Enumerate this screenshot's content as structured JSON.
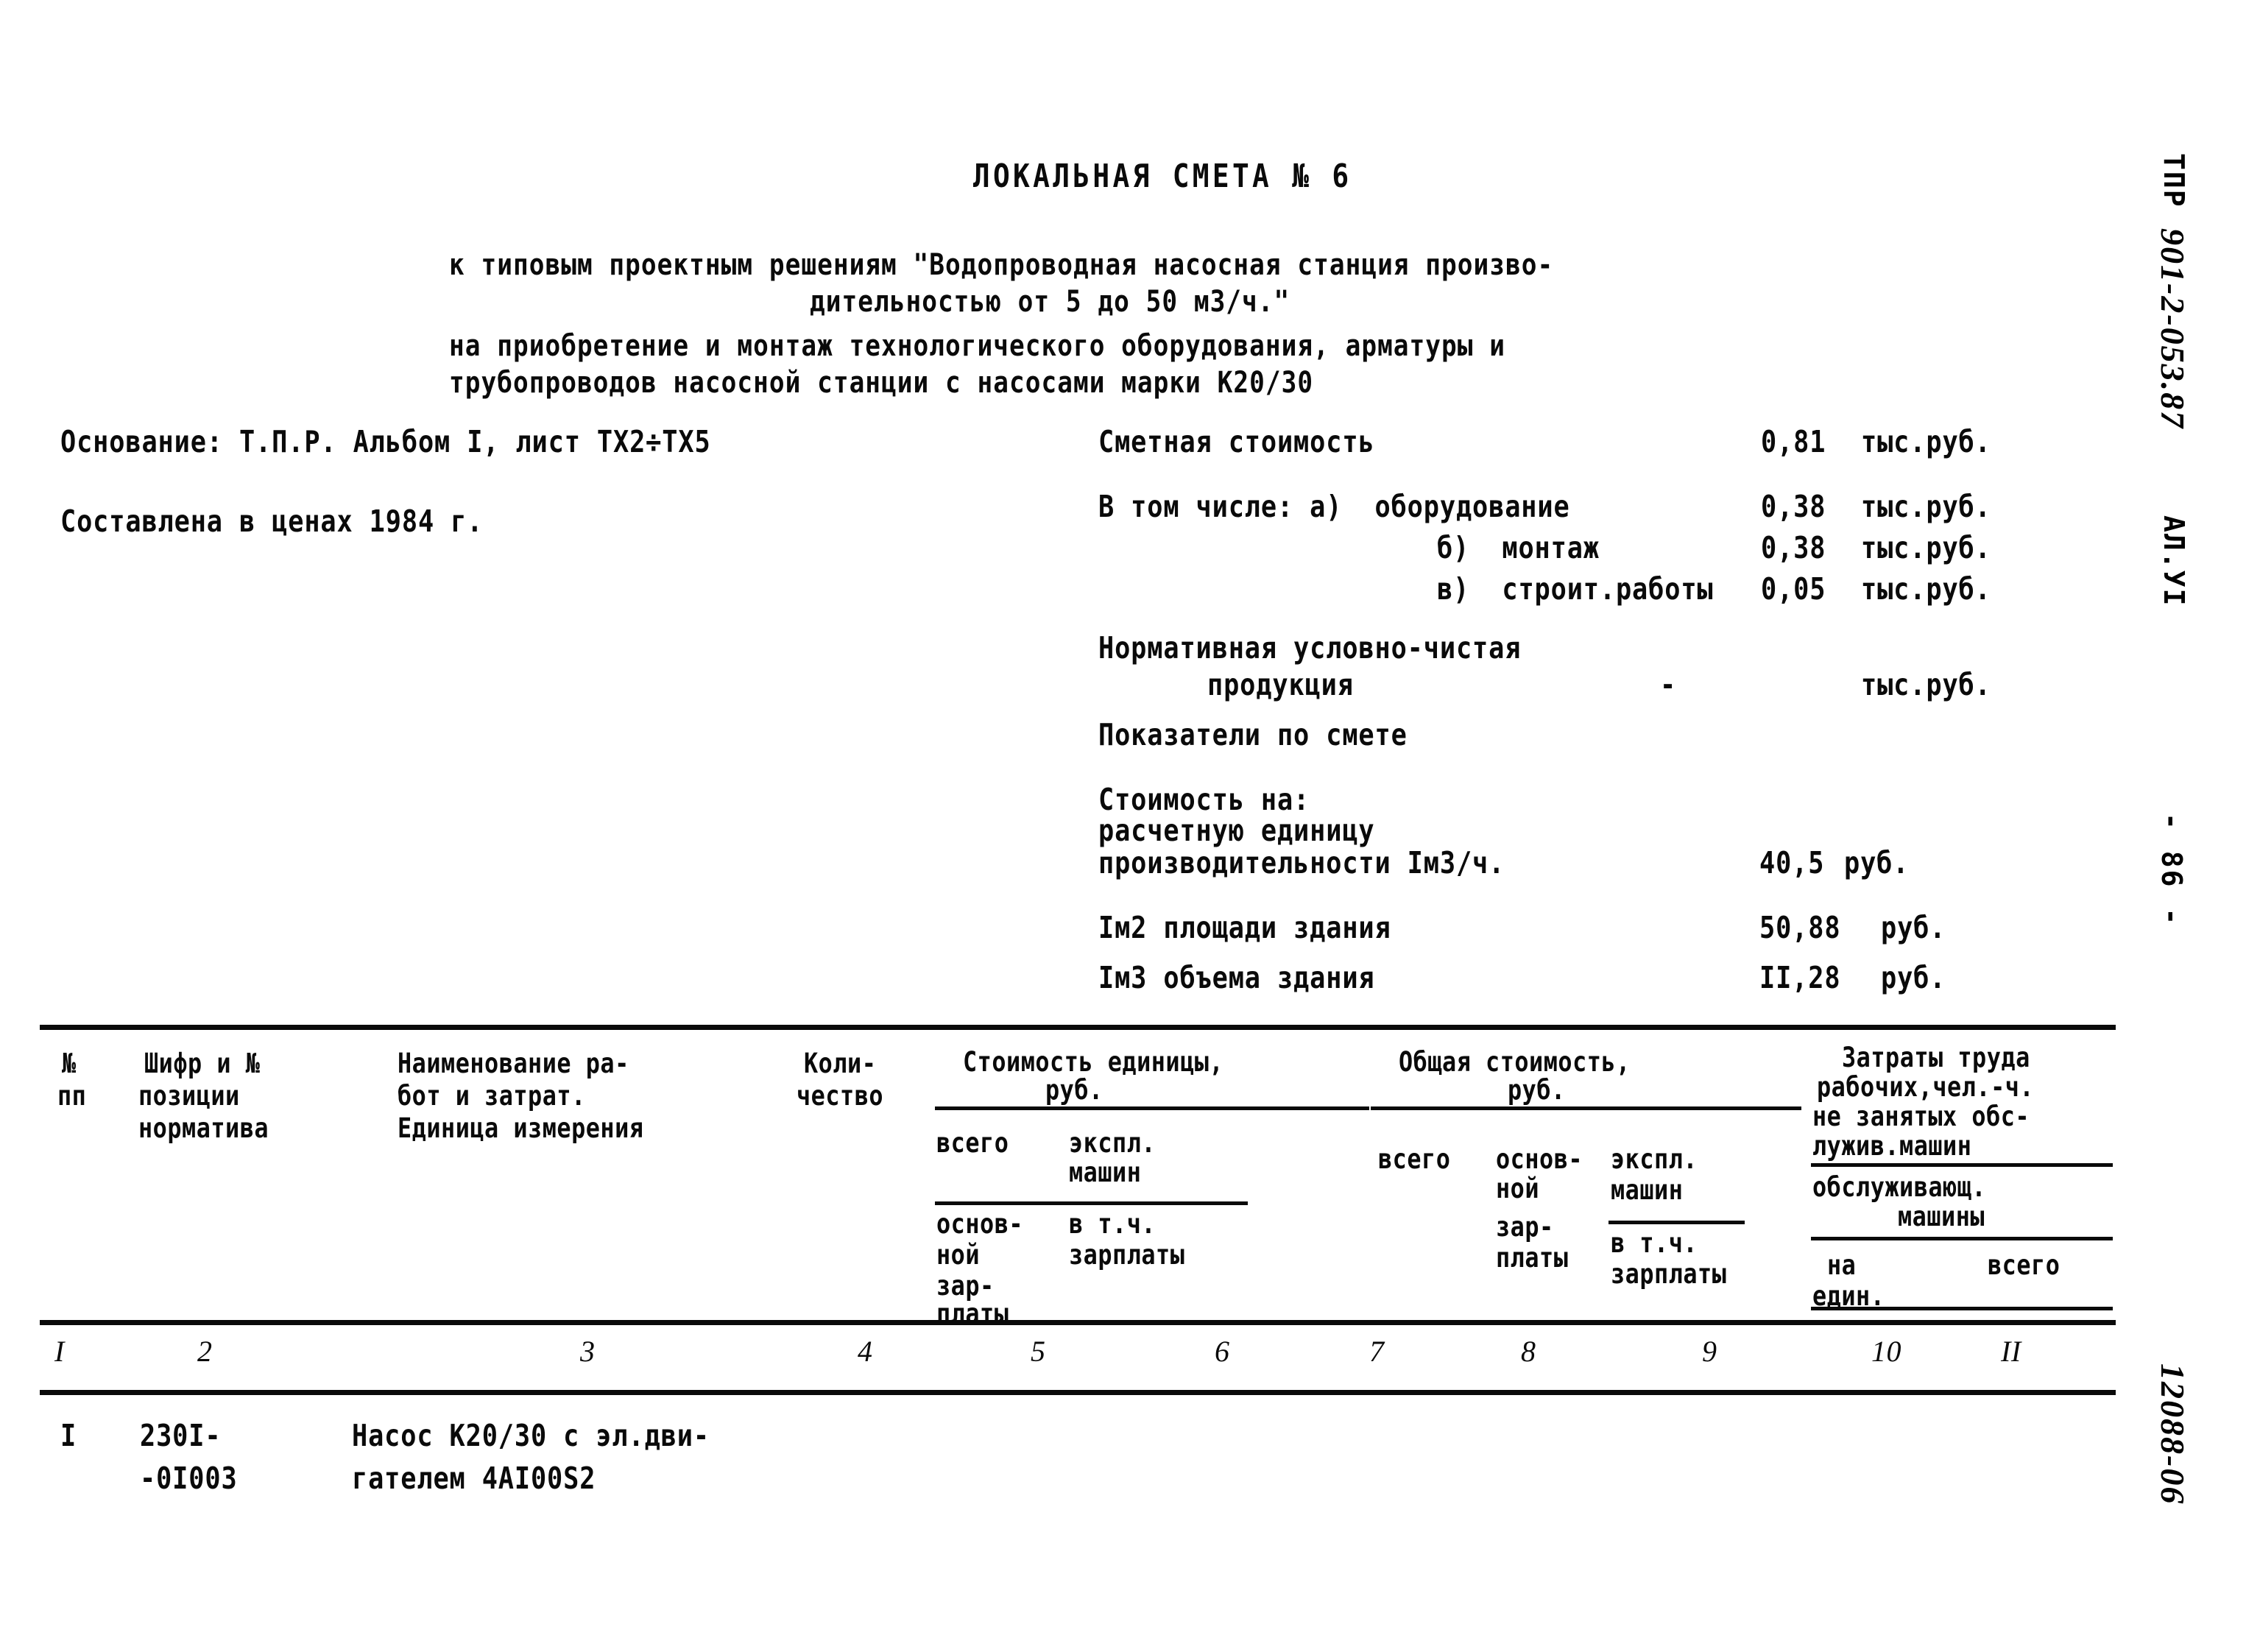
{
  "document": {
    "title": "ЛОКАЛЬНАЯ СМЕТА № 6",
    "subtitle_line1": "к типовым проектным решениям \"Водопроводная насосная станция произво-",
    "subtitle_line2": "дительностью от 5 до 50 м3/ч.\"",
    "subtitle_line3": "на приобретение и монтаж технологического оборудования, арматуры и",
    "subtitle_line4": "трубопроводов насосной станции с насосами марки К20/30"
  },
  "left_info": {
    "basis": "Основание: Т.П.Р. Альбом I, лист ТХ2÷ТХ5",
    "prices": "Составлена в ценах 1984 г."
  },
  "right_info": {
    "estimate_cost_label": "Сметная стоимость",
    "estimate_cost_value": "0,81",
    "estimate_cost_unit": "тыс.руб.",
    "including_label": "В том числе: а)  оборудование",
    "including_a_value": "0,38",
    "including_a_unit": "тыс.руб.",
    "including_b_label": "б)  монтаж",
    "including_b_value": "0,38",
    "including_b_unit": "тыс.руб.",
    "including_c_label": "в)  строит.работы",
    "including_c_value": "0,05",
    "including_c_unit": "тыс.руб.",
    "nuchp_line1": "Нормативная условно-чистая",
    "nuchp_line2": "продукция",
    "nuchp_value": "-",
    "nuchp_unit": "тыс.руб.",
    "indicators_label": "Показатели по смете",
    "cost_for_label": "Стоимость на:",
    "unit_calc_line1": "расчетную единицу",
    "unit_calc_line2": "производительности Iм3/ч.",
    "unit_calc_value": "40,5",
    "unit_calc_unit": "руб.",
    "area_label": "Iм2 площади здания",
    "area_value": "50,88",
    "area_unit": "руб.",
    "volume_label": "Iм3 объема здания",
    "volume_value": "II,28",
    "volume_unit": "руб."
  },
  "table": {
    "headers": {
      "c1_line1": "№",
      "c1_line2": "пп",
      "c2_line1": "Шифр и №",
      "c2_line2": "позиции",
      "c2_line3": "норматива",
      "c3_line1": "Наименование ра-",
      "c3_line2": "бот и затрат.",
      "c3_line3": "Единица измерения",
      "c4_line1": "Коли-",
      "c4_line2": "чество",
      "g_unit_cost_line1": "Стоимость единицы,",
      "g_unit_cost_line2": "руб.",
      "g_total_cost_line1": "Общая стоимость,",
      "g_total_cost_line2": "руб.",
      "g_labor_line1": "Затраты труда",
      "g_labor_line2": "рабочих,чел.-ч.",
      "g_labor_line3": "не занятых обс-",
      "g_labor_line4": "лужив.машин",
      "c5_top": "всего",
      "c5_bot_line1": "основ-",
      "c5_bot_line2": "ной",
      "c5_bot_line3": "зар-",
      "c5_bot_line4": "платы",
      "c6_top_line1": "экспл.",
      "c6_top_line2": "машин",
      "c6_bot_line1": "в т.ч.",
      "c6_bot_line2": "зарплаты",
      "c7": "всего",
      "c8_line1": "основ-",
      "c8_line2": "ной",
      "c8_line3": "зар-",
      "c8_line4": "платы",
      "c9_top_line1": "экспл.",
      "c9_top_line2": "машин",
      "c9_bot_line1": "в т.ч.",
      "c9_bot_line2": "зарплаты",
      "c10_11_mid_line1": "обслуживающ.",
      "c10_11_mid_line2": "машины",
      "c10": "на",
      "c10_line2": "един.",
      "c11": "всего"
    },
    "column_numbers": [
      "I",
      "2",
      "3",
      "4",
      "5",
      "6",
      "7",
      "8",
      "9",
      "10",
      "II"
    ],
    "rows": [
      {
        "num": "I",
        "code_line1": "230I-",
        "code_line2": "-0I003",
        "name_line1": "Насос К20/30 с эл.дви-",
        "name_line2": "гателем 4АI00S2",
        "qty": "",
        "unit_total": "",
        "unit_machines": "",
        "total_all": "",
        "total_salary": "",
        "total_machines": "",
        "labor_per_unit": "",
        "labor_total": ""
      }
    ]
  },
  "margins": {
    "top_right_typed": "ТПР",
    "top_right_hand": "901-2-053.87",
    "top_right_typed2": "АЛ.УI",
    "page_number": "- 86 -",
    "bottom_right_hand": "12088-06"
  }
}
